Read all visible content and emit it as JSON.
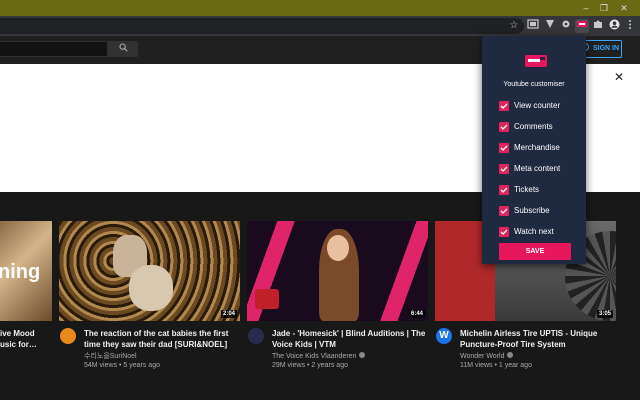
{
  "browser": {
    "window_controls": {
      "minimize": "–",
      "restore": "❐",
      "close": "✕"
    },
    "icons": [
      "star-icon",
      "cast-icon",
      "extension-icon",
      "puzzle-icon",
      "profile-icon",
      "menu-icon"
    ]
  },
  "youtube": {
    "header": {
      "search_button_icon": "search-icon",
      "signin_label": "SIGN IN"
    },
    "banner": {
      "close_glyph": "✕"
    }
  },
  "videos": [
    {
      "title_line1": "ive Mood",
      "title_line2": "usic for…",
      "thumb_text": "ning"
    },
    {
      "duration": "2:04",
      "title_line1": "The reaction of the cat babies the first",
      "title_line2": "time they saw their dad [SURI&NOEL]",
      "channel": "수리노을SuriNoel",
      "meta": "54M views • 5 years ago"
    },
    {
      "duration": "6:44",
      "title_line1": "Jade - 'Homesick' | Blind Auditions | The",
      "title_line2": "Voice Kids | VTM",
      "channel": "The Voice Kids Vlaanderen",
      "meta": "29M views • 2 years ago"
    },
    {
      "duration": "3:05",
      "title_line1": "Michelin Airless Tire UPTIS - Unique",
      "title_line2": "Puncture-Proof Tire System",
      "channel": "Wonder World",
      "meta": "11M views • 1 year ago",
      "avatar_letter": "W"
    }
  ],
  "popup": {
    "title": "Youtube customiser",
    "options": [
      {
        "label": "View counter",
        "checked": true
      },
      {
        "label": "Comments",
        "checked": true
      },
      {
        "label": "Merchandise",
        "checked": true
      },
      {
        "label": "Meta content",
        "checked": true
      },
      {
        "label": "Tickets",
        "checked": true
      },
      {
        "label": "Subscribe",
        "checked": true
      },
      {
        "label": "Watch next",
        "checked": true
      }
    ],
    "save_label": "SAVE"
  },
  "colors": {
    "accent": "#e8175d",
    "link_blue": "#3ea6ff",
    "popup_bg": "#1f2940",
    "titlebar": "#6b6a14"
  }
}
